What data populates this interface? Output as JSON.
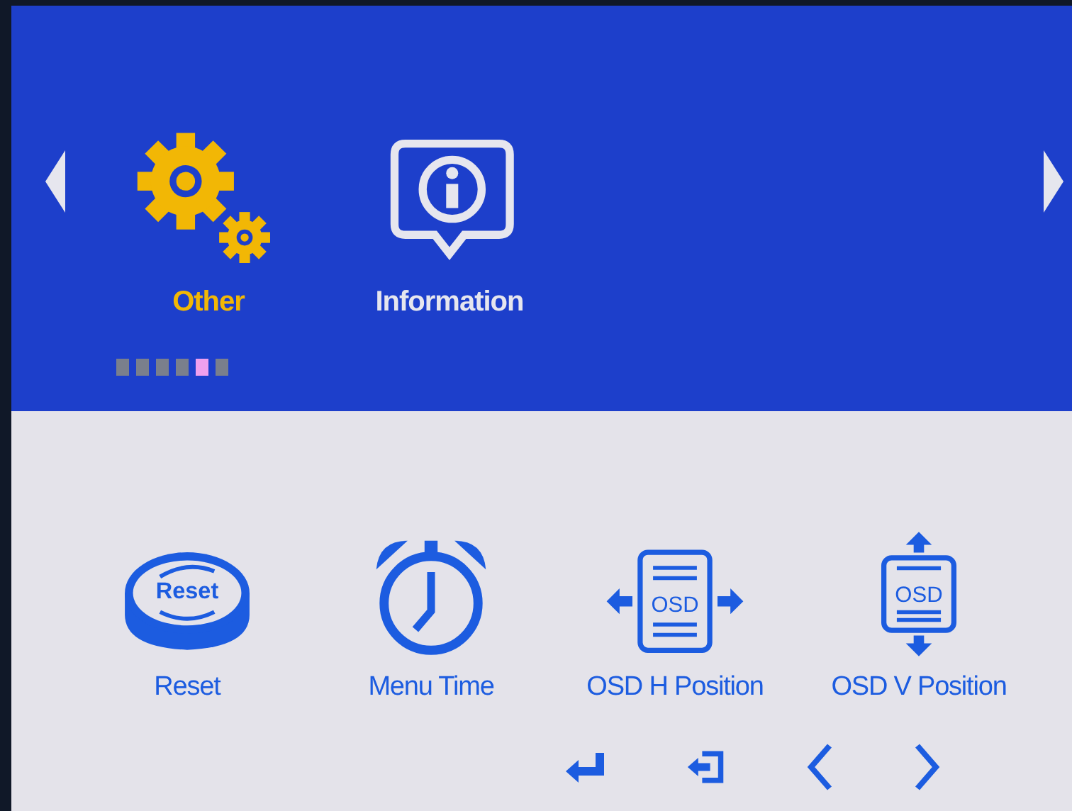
{
  "categories": [
    {
      "label": "Other",
      "selected": true,
      "kind": "gears"
    },
    {
      "label": "Information",
      "selected": false,
      "kind": "info"
    }
  ],
  "page_dots": [
    {
      "selected": false
    },
    {
      "selected": false
    },
    {
      "selected": false
    },
    {
      "selected": false
    },
    {
      "selected": true
    },
    {
      "selected": false
    }
  ],
  "items": [
    {
      "label": "Reset",
      "kind": "reset",
      "icon_text": "Reset"
    },
    {
      "label": "Menu Time",
      "kind": "clock"
    },
    {
      "label": "OSD H Position",
      "kind": "osd_h",
      "icon_text": "OSD"
    },
    {
      "label": "OSD V Position",
      "kind": "osd_v",
      "icon_text": "OSD"
    }
  ],
  "keys": [
    {
      "kind": "enter"
    },
    {
      "kind": "exit"
    },
    {
      "kind": "left"
    },
    {
      "kind": "right"
    }
  ]
}
